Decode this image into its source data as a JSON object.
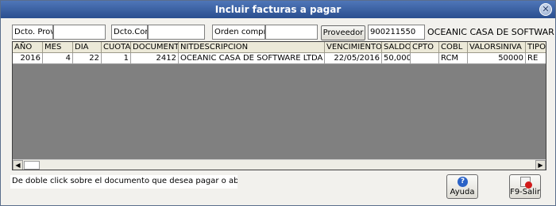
{
  "window": {
    "title": "Incluir facturas a pagar"
  },
  "filters": {
    "dcto_prov_label": "Dcto. Prov.",
    "dcto_prov_value": "",
    "dcto_cont_label": "Dcto.Cont",
    "dcto_cont_value": "",
    "orden_compra_label": "Orden compra",
    "orden_compra_value": "",
    "proveedor_button": "Proveedor",
    "proveedor_nit": "900211550",
    "proveedor_name": "OCEANIC CASA DE SOFTWARE LT"
  },
  "grid": {
    "columns": [
      "AÑO",
      "MES",
      "DIA",
      "CUOTA",
      "DOCUMENTO",
      "NITDESCRIPCION",
      "VENCIMIENTO",
      "SALDO",
      "CPTO",
      "COBL",
      "VALORSINIVA",
      "TIPO"
    ],
    "rows": [
      [
        "2016",
        "4",
        "22",
        "1",
        "2412",
        "OCEANIC CASA DE SOFTWARE LTDA",
        "22/05/2016",
        "50,000",
        "",
        "RCM",
        "50000",
        "RE"
      ]
    ]
  },
  "footer": {
    "hint": "De doble click sobre el documento que desea pagar o abonar",
    "help_button": "Ayuda",
    "exit_button": "F9-Salir"
  },
  "icons": {
    "close": "close-icon",
    "help": "help-icon",
    "exit": "exit-icon"
  }
}
